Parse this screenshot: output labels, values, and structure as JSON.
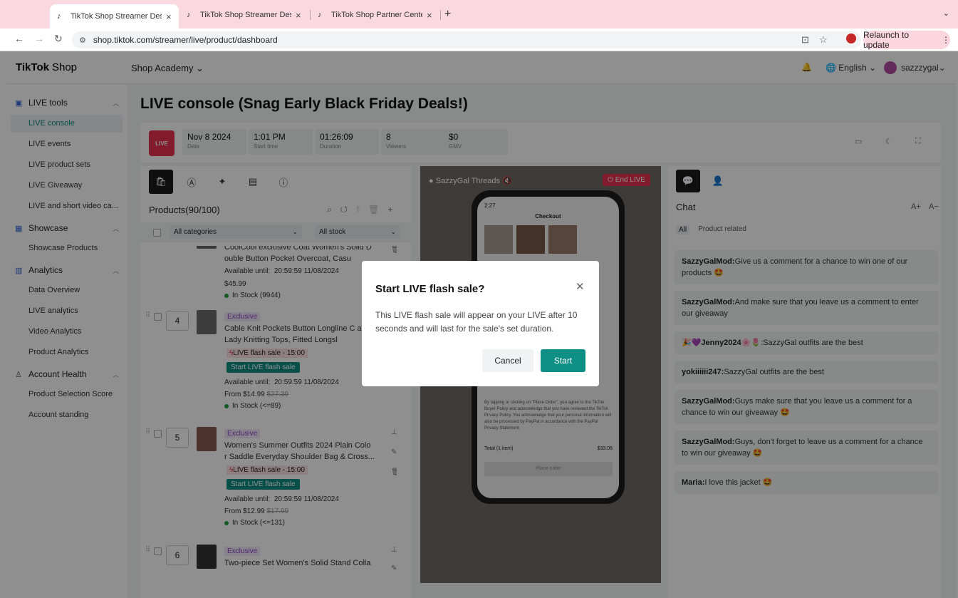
{
  "browser": {
    "tabs": [
      {
        "title": "TikTok Shop Streamer Deskto",
        "active": true
      },
      {
        "title": "TikTok Shop Streamer Deskto",
        "active": false
      },
      {
        "title": "TikTok Shop Partner Center",
        "active": false
      }
    ],
    "url": "shop.tiktok.com/streamer/live/product/dashboard",
    "relaunch": "Relaunch to update"
  },
  "topnav": {
    "logo": "TikTok",
    "logo_suffix": "Shop",
    "academy": "Shop Academy",
    "language": "English",
    "username": "sazzzygal"
  },
  "sidebar": {
    "live_tools": "LIVE tools",
    "live_items": [
      "LIVE console",
      "LIVE events",
      "LIVE product sets",
      "LIVE Giveaway",
      "LIVE and short video ca..."
    ],
    "showcase": "Showcase",
    "showcase_items": [
      "Showcase Products"
    ],
    "analytics": "Analytics",
    "analytics_items": [
      "Data Overview",
      "LIVE analytics",
      "Video Analytics",
      "Product Analytics"
    ],
    "account_health": "Account Health",
    "account_items": [
      "Product Selection Score",
      "Account standing"
    ]
  },
  "main": {
    "title": "LIVE console (Snag Early Black Friday Deals!)",
    "live_badge": "LIVE",
    "stats": [
      {
        "value": "Nov 8 2024",
        "label": "Date"
      },
      {
        "value": "1:01 PM",
        "label": "Start time"
      },
      {
        "value": "01:26:09",
        "label": "Duration"
      },
      {
        "value": "8",
        "label": "Viewers"
      },
      {
        "value": "$0",
        "label": "GMV"
      }
    ]
  },
  "products": {
    "title": "Products(90/100)",
    "category_filter": "All categories",
    "stock_filter": "All stock",
    "items": [
      {
        "name": "CoolCool exclusive Coat Women's Solid D ouble Button Pocket Overcoat, Casu",
        "available": "Available until:",
        "available_date": "20:59:59 11/08/2024",
        "price": "$45.99",
        "stock": "In Stock (9944)"
      },
      {
        "num": "4",
        "badge": "Exclusive",
        "name": "Cable Knit Pockets Button Longline C an, Lady Knitting Tops, Fitted Longsl",
        "flash": "LIVE flash sale - 15:00",
        "flash_btn": "Start LIVE flash sale",
        "available": "Available until:",
        "available_date": "20:59:59 11/08/2024",
        "price_from": "From $14.99",
        "price_orig": "$27.39",
        "stock": "In Stock (<=89)"
      },
      {
        "num": "5",
        "badge": "Exclusive",
        "name": "Women's Summer Outfits 2024 Plain Colo r Saddle Everyday Shoulder Bag & Cross...",
        "flash": "LIVE flash sale - 15:00",
        "flash_btn": "Start LIVE flash sale",
        "available": "Available until:",
        "available_date": "20:59:59 11/08/2024",
        "price_from": "From $12.99",
        "price_orig": "$17.99",
        "stock": "In Stock (<=131)"
      },
      {
        "num": "6",
        "badge": "Exclusive",
        "name": "Two-piece Set Women's Solid Stand Colla"
      }
    ]
  },
  "video": {
    "host": "SazzyGal Threads",
    "end_live": "End LIVE",
    "phone_time": "2:27",
    "phone_title": "Checkout",
    "legal": "By tapping or clicking on \"Place Order\", you agree to the TikTok Buyer Policy and acknowledge that you have reviewed the TikTok Privacy Policy. You acknowledge that your personal information will also be processed by PayPal in accordance with the PayPal Privacy Statement.",
    "total_label": "Total (1 item)",
    "total_value": "$33.05",
    "place_order": "Place order"
  },
  "chat": {
    "title": "Chat",
    "font_up": "A+",
    "font_down": "A−",
    "tab_all": "All",
    "tab_product": "Product related",
    "messages": [
      {
        "user": "SazzyGalMod:",
        "text": "Give us a comment for a chance to win one of our products 🤩"
      },
      {
        "user": "SazzyGalMod:",
        "text": "And make sure that you leave us a comment to enter our giveaway"
      },
      {
        "user": "🎉💜Jenny2024🌸🌷",
        "text": ":SazzyGal outfits are the best"
      },
      {
        "user": "yokiiiiii247:",
        "text": "SazzyGal outfits are the best"
      },
      {
        "user": "SazzyGalMod:",
        "text": "Guys make sure that you leave us a comment for a chance to win our giveaway 🤩"
      },
      {
        "user": "SazzyGalMod:",
        "text": "Guys, don't forget to leave us a comment for a chance to win our giveaway 🤩"
      },
      {
        "user": "Maria:",
        "text": "I love this jacket 🤩"
      }
    ]
  },
  "dialog": {
    "title": "Start LIVE flash sale?",
    "body": "This LIVE flash sale will appear on your LIVE after 10 seconds and will last for the sale's set duration.",
    "cancel": "Cancel",
    "start": "Start"
  },
  "colors": {
    "accent": "#0e8f85",
    "live_red": "#e8334f",
    "tab_bar": "#f9d8e0"
  }
}
